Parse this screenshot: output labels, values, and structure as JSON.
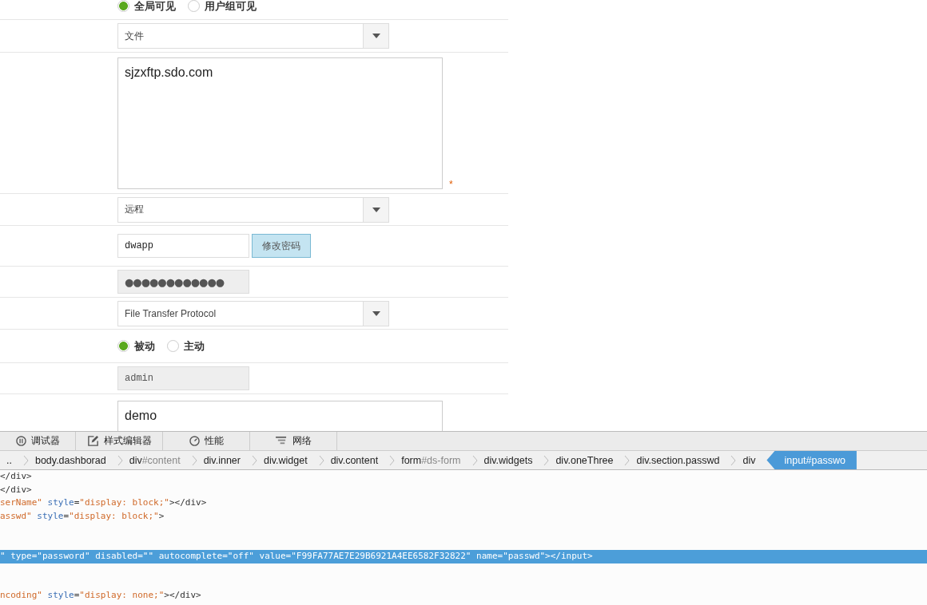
{
  "form": {
    "rows": [
      {
        "kind": "radio",
        "options": [
          {
            "label": "全局可见",
            "selected": true
          },
          {
            "label": "用户组可见",
            "selected": false
          }
        ]
      },
      {
        "kind": "select",
        "value": "文件"
      },
      {
        "kind": "textarea",
        "value": "sjzxftp.sdo.com",
        "required_mark": "*"
      },
      {
        "kind": "select",
        "value": "远程"
      },
      {
        "kind": "text_button",
        "value": "dwapp",
        "button": "修改密码"
      },
      {
        "kind": "masked",
        "value": "●●●●●●●●●●●●",
        "disabled": true
      },
      {
        "kind": "select",
        "value": "File Transfer Protocol"
      },
      {
        "kind": "radio",
        "options": [
          {
            "label": "被动",
            "selected": true
          },
          {
            "label": "主动",
            "selected": false
          }
        ]
      },
      {
        "kind": "text",
        "value": "admin",
        "disabled": true
      },
      {
        "kind": "textarea_cut",
        "value": "demo"
      }
    ]
  },
  "devtools": {
    "tabs": [
      {
        "label": "调试器"
      },
      {
        "label": "样式编辑器"
      },
      {
        "label": "性能"
      },
      {
        "label": "网络"
      }
    ],
    "breadcrumbs": [
      {
        "tag": "..",
        "selected": false
      },
      {
        "tag": "body.dashborad",
        "selected": false
      },
      {
        "tag": "div",
        "id": "#content",
        "selected": false
      },
      {
        "tag": "div.inner",
        "selected": false
      },
      {
        "tag": "div.widget",
        "selected": false
      },
      {
        "tag": "div.content",
        "selected": false
      },
      {
        "tag": "form",
        "id": "#ds-form",
        "selected": false
      },
      {
        "tag": "div.widgets",
        "selected": false
      },
      {
        "tag": "div.oneThree",
        "selected": false
      },
      {
        "tag": "div.section.passwd",
        "selected": false
      },
      {
        "tag": "div",
        "selected": false
      },
      {
        "tag": "input",
        "id": "#passwo",
        "selected": true
      }
    ],
    "code_lines": [
      {
        "selected": false,
        "tokens": [
          {
            "kind": "tag",
            "text": "</div>"
          }
        ]
      },
      {
        "selected": false,
        "tokens": [
          {
            "kind": "tag",
            "text": "</div>"
          }
        ]
      },
      {
        "selected": false,
        "tokens": [
          {
            "kind": "value",
            "text": "serName\""
          },
          {
            "kind": "attr",
            "text": " style"
          },
          {
            "kind": "tag",
            "text": "="
          },
          {
            "kind": "value",
            "text": "\"display: block;\""
          },
          {
            "kind": "tag",
            "text": "></div>"
          }
        ]
      },
      {
        "selected": false,
        "tokens": [
          {
            "kind": "value",
            "text": "asswd\""
          },
          {
            "kind": "attr",
            "text": " style"
          },
          {
            "kind": "tag",
            "text": "="
          },
          {
            "kind": "value",
            "text": "\"display: block;\""
          },
          {
            "kind": "tag",
            "text": ">"
          }
        ]
      },
      {
        "selected": true,
        "tokens": [
          {
            "kind": "value",
            "text": "\" type=\"password\" disabled=\"\" autocomplete=\"off\" value=\"F99FA77AE7E29B6921A4EE6582F32822\" name=\"passwd\"></input>"
          }
        ]
      },
      {
        "selected": false,
        "tokens": [
          {
            "kind": "value",
            "text": "ncoding\""
          },
          {
            "kind": "attr",
            "text": " style"
          },
          {
            "kind": "tag",
            "text": "="
          },
          {
            "kind": "value",
            "text": "\"display: none;\""
          },
          {
            "kind": "tag",
            "text": "></div>"
          }
        ]
      }
    ]
  }
}
